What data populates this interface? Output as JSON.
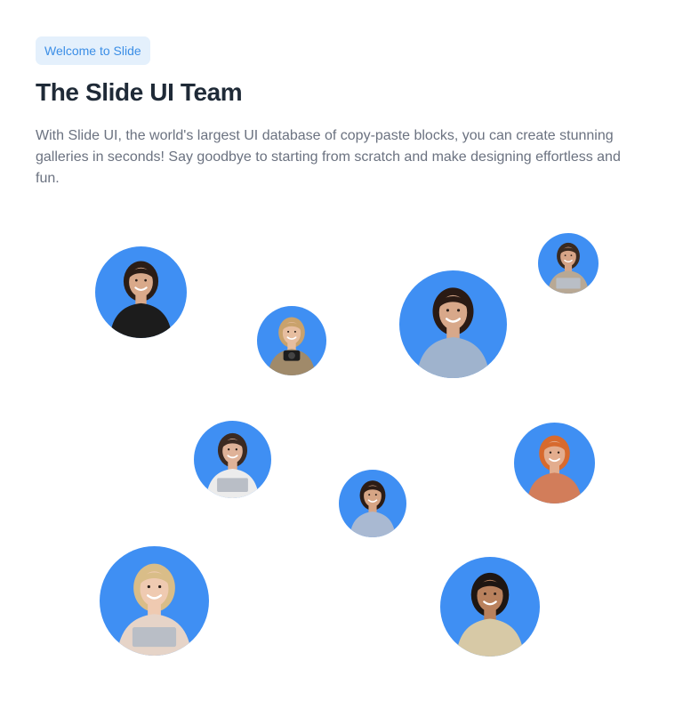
{
  "header": {
    "badge": "Welcome to Slide",
    "title": "The Slide UI Team",
    "description": "With Slide UI, the world's largest UI database of copy-paste blocks, you can create stunning galleries in seconds! Say goodbye to starting from scratch and make designing effortless and fun."
  },
  "colors": {
    "avatar_background": "#3f8ff3",
    "badge_background": "#e4f0fc",
    "badge_text": "#3b8ee6",
    "title_text": "#1f2a37",
    "body_text": "#6b7280"
  },
  "team": [
    {
      "id": "member-1",
      "hair": "#2b1d16",
      "skin": "#d9a98a",
      "shirt": "#1c1c1c",
      "prop": "none"
    },
    {
      "id": "member-2",
      "hair": "#c9a26c",
      "skin": "#e7bea0",
      "shirt": "#a08a6a",
      "prop": "camera"
    },
    {
      "id": "member-3",
      "hair": "#2a1a14",
      "skin": "#d8a88a",
      "shirt": "#9fb3cd",
      "prop": "none"
    },
    {
      "id": "member-4",
      "hair": "#3a2a20",
      "skin": "#d6a487",
      "shirt": "#b8a894",
      "prop": "laptop"
    },
    {
      "id": "member-5",
      "hair": "#3b2a22",
      "skin": "#dfb298",
      "shirt": "#ececec",
      "prop": "laptop"
    },
    {
      "id": "member-6",
      "hair": "#2c1c15",
      "skin": "#d6a585",
      "shirt": "#a9b9d2",
      "prop": "none"
    },
    {
      "id": "member-7",
      "hair": "#d76a2e",
      "skin": "#e3ad8e",
      "shirt": "#d27d5a",
      "prop": "none"
    },
    {
      "id": "member-8",
      "hair": "#d9bd88",
      "skin": "#efcab1",
      "shirt": "#e6d4c8",
      "prop": "laptop"
    },
    {
      "id": "member-9",
      "hair": "#1e1612",
      "skin": "#b9815d",
      "shirt": "#d7c9a6",
      "prop": "none"
    }
  ]
}
